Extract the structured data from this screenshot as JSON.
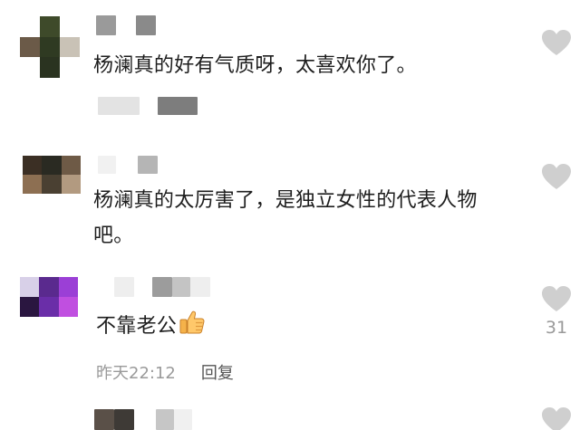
{
  "comments": [
    {
      "text": "杨澜真的好有气质呀，太喜欢你了。",
      "like_icon": "heart-icon"
    },
    {
      "text_line1": "杨澜真的太厉害了，是独立女性的代表人物",
      "text_line2": "吧。",
      "like_icon": "heart-icon"
    },
    {
      "text": "不靠老公",
      "emoji": "thumbs-up-icon",
      "like_icon": "heart-icon",
      "like_count": "31",
      "time": "昨天22:12",
      "reply_label": "回复"
    },
    {
      "like_icon": "heart-icon"
    }
  ],
  "colors": {
    "text": "#1e1e1e",
    "meta": "#9a9a9a",
    "heart": "#cfcfcf"
  }
}
